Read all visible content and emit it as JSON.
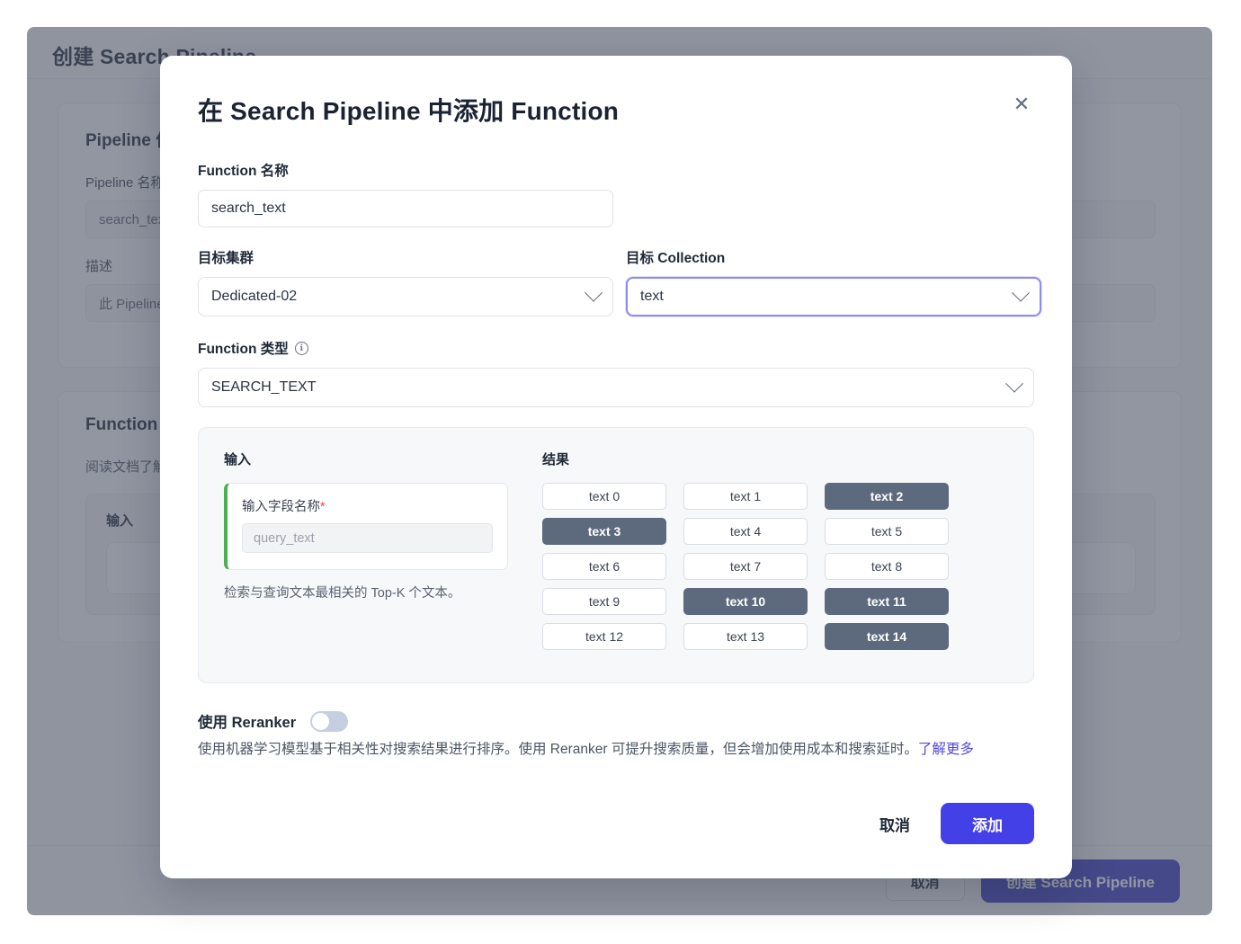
{
  "background": {
    "page_title": "创建 Search Pipeline",
    "pipeline_card": {
      "title": "Pipeline 信息",
      "name_label": "Pipeline 名称",
      "name_value": "search_text_pipeline",
      "desc_label": "描述",
      "desc_value": "此 Pipeline 用于检索文本"
    },
    "function_card": {
      "title": "Function",
      "subtitle": "阅读文档了解更多关于 Function 的信息",
      "input_label": "输入"
    },
    "footer": {
      "cancel_label": "取消",
      "create_label": "创建 Search Pipeline"
    }
  },
  "modal": {
    "title": "在 Search Pipeline 中添加 Function",
    "close_icon": "close-icon",
    "function_name": {
      "label": "Function 名称",
      "value": "search_text"
    },
    "target_cluster": {
      "label": "目标集群",
      "value": "Dedicated-02"
    },
    "target_collection": {
      "label": "目标 Collection",
      "value": "text"
    },
    "function_type": {
      "label": "Function 类型",
      "info_icon": "info-icon",
      "info_glyph": "i",
      "value": "SEARCH_TEXT"
    },
    "preview": {
      "input_column_label": "输入",
      "input_field_label": "输入字段名称",
      "required_mark": "*",
      "input_field_placeholder": "query_text",
      "input_note": "检索与查询文本最相关的 Top-K 个文本。",
      "results_column_label": "结果",
      "results": [
        {
          "label": "text 0",
          "selected": false
        },
        {
          "label": "text 1",
          "selected": false
        },
        {
          "label": "text 2",
          "selected": true
        },
        {
          "label": "text 3",
          "selected": true
        },
        {
          "label": "text 4",
          "selected": false
        },
        {
          "label": "text 5",
          "selected": false
        },
        {
          "label": "text 6",
          "selected": false
        },
        {
          "label": "text 7",
          "selected": false
        },
        {
          "label": "text 8",
          "selected": false
        },
        {
          "label": "text 9",
          "selected": false
        },
        {
          "label": "text 10",
          "selected": true
        },
        {
          "label": "text 11",
          "selected": true
        },
        {
          "label": "text 12",
          "selected": false
        },
        {
          "label": "text 13",
          "selected": false
        },
        {
          "label": "text 14",
          "selected": true
        }
      ]
    },
    "reranker": {
      "title": "使用 Reranker",
      "enabled": false,
      "description": "使用机器学习模型基于相关性对搜索结果进行排序。使用 Reranker 可提升搜索质量，但会增加使用成本和搜索延时。",
      "link_label": "了解更多"
    },
    "footer": {
      "cancel_label": "取消",
      "add_label": "添加"
    }
  },
  "colors": {
    "primary": "#4340e8",
    "background_primary": "#3a3ac4",
    "chip_selected": "#5d6a7e",
    "focus_border": "#8a8cf0",
    "accent_green": "#4caf50",
    "required_red": "#e5484d",
    "link": "#4f46e5"
  }
}
